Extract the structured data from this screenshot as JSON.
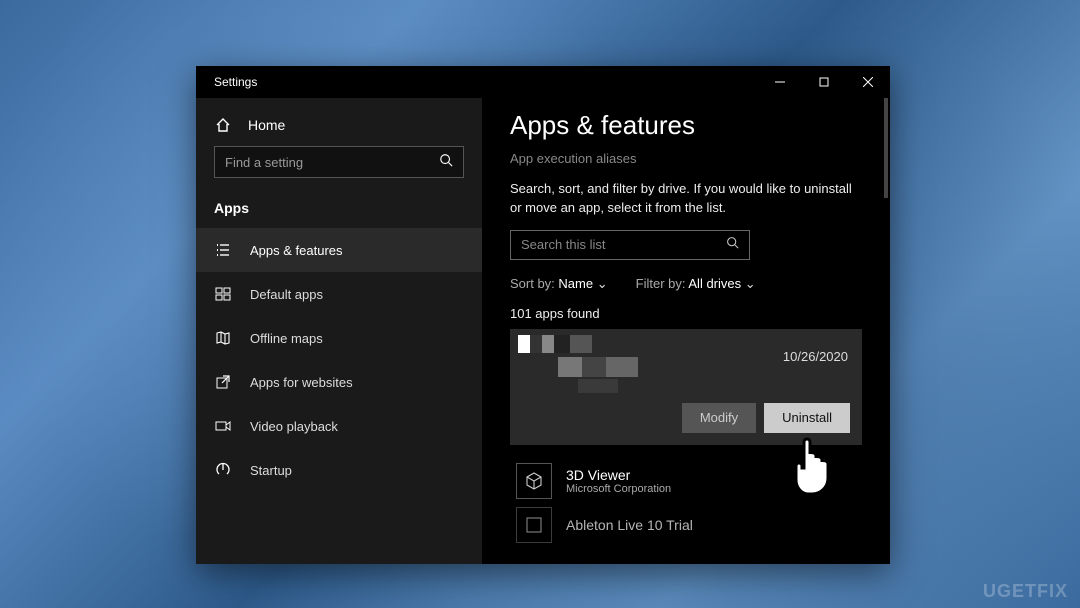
{
  "window": {
    "title": "Settings"
  },
  "sidebar": {
    "home": "Home",
    "search_placeholder": "Find a setting",
    "section": "Apps",
    "items": [
      {
        "label": "Apps & features"
      },
      {
        "label": "Default apps"
      },
      {
        "label": "Offline maps"
      },
      {
        "label": "Apps for websites"
      },
      {
        "label": "Video playback"
      },
      {
        "label": "Startup"
      }
    ]
  },
  "content": {
    "heading": "Apps & features",
    "aliases_link": "App execution aliases",
    "description": "Search, sort, and filter by drive. If you would like to uninstall or move an app, select it from the list.",
    "search_placeholder": "Search this list",
    "sort": {
      "label": "Sort by:",
      "value": "Name"
    },
    "filter": {
      "label": "Filter by:",
      "value": "All drives"
    },
    "count_text": "101 apps found",
    "selected_app": {
      "date": "10/26/2020",
      "modify": "Modify",
      "uninstall": "Uninstall"
    },
    "apps": [
      {
        "name": "3D Viewer",
        "publisher": "Microsoft Corporation"
      },
      {
        "name": "Ableton Live 10 Trial",
        "publisher": ""
      }
    ]
  },
  "watermark": "UGETFIX"
}
